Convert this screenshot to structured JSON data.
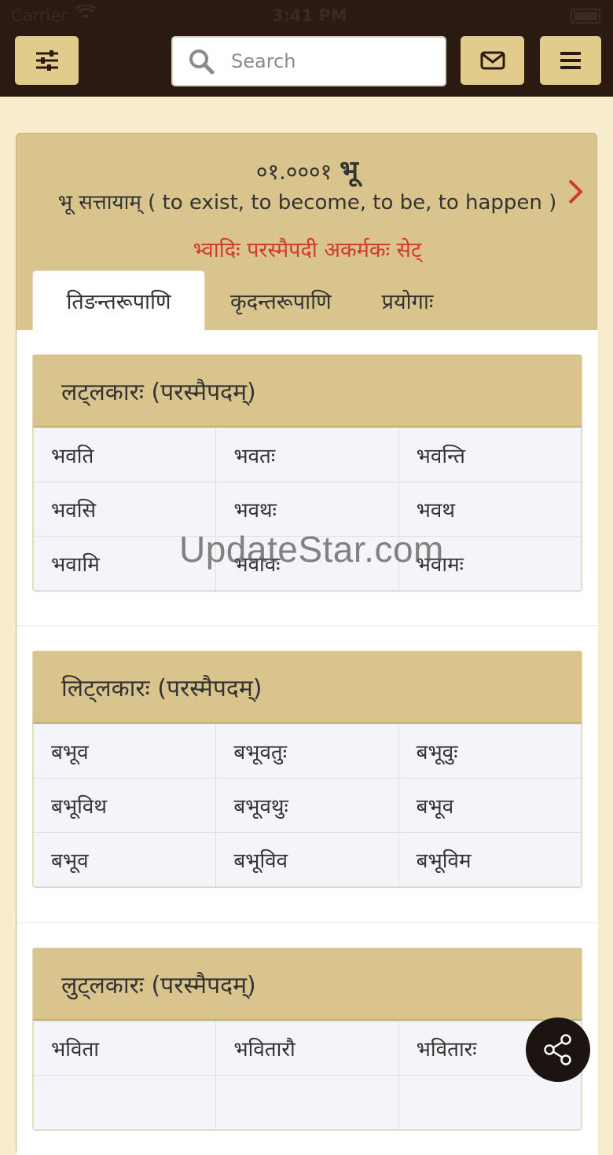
{
  "status_bar": {
    "carrier": "Carrier",
    "time": "3:41 PM"
  },
  "header": {
    "search_placeholder": "Search",
    "icons": {
      "filter": "sliders-icon",
      "mail": "envelope-icon",
      "menu": "hamburger-icon",
      "search": "search-icon"
    }
  },
  "dhatu": {
    "code": "०१.०००१",
    "root": "भू",
    "meaning": "भू सत्तायाम्  ( to exist, to become, to be, to happen )",
    "tags": "भ्वादिः  परस्मैपदी  अकर्मकः  सेट्"
  },
  "tabs": [
    {
      "label": "तिङन्तरूपाणि",
      "active": true
    },
    {
      "label": "कृदन्तरूपाणि",
      "active": false
    },
    {
      "label": "प्रयोगाः",
      "active": false
    }
  ],
  "lakaras": [
    {
      "title": "लट्लकारः (परस्मैपदम्)",
      "rows": [
        [
          "भवति",
          "भवतः",
          "भवन्ति"
        ],
        [
          "भवसि",
          "भवथः",
          "भवथ"
        ],
        [
          "भवामि",
          "भवावः",
          "भवामः"
        ]
      ]
    },
    {
      "title": "लिट्लकारः (परस्मैपदम्)",
      "rows": [
        [
          "बभूव",
          "बभूवतुः",
          "बभूवुः"
        ],
        [
          "बभूविथ",
          "बभूवथुः",
          "बभूव"
        ],
        [
          "बभूव",
          "बभूविव",
          "बभूविम"
        ]
      ]
    },
    {
      "title": "लुट्लकारः (परस्मैपदम्)",
      "rows": [
        [
          "भविता",
          "भवितारौ",
          "भवितारः"
        ],
        [
          "",
          "",
          ""
        ]
      ]
    }
  ],
  "watermark": "UpdateStar.com",
  "colors": {
    "header_bg": "#2a1a12",
    "accent": "#d9c48d",
    "tag_red": "#d23a2a",
    "page_bg": "#f7eccb"
  }
}
